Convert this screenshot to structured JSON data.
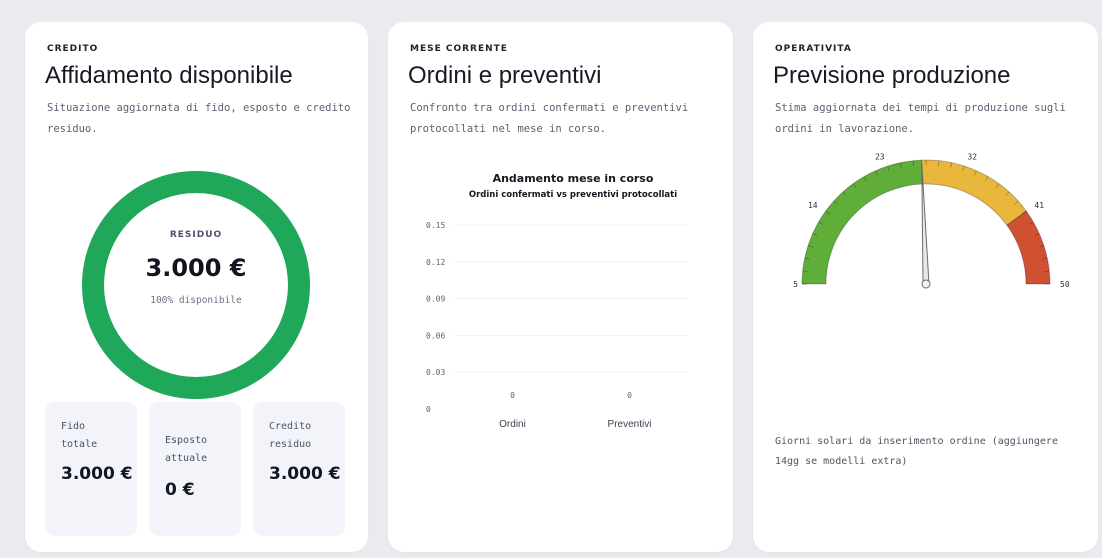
{
  "credit_card": {
    "eyebrow": "CREDITO",
    "title": "Affidamento disponibile",
    "description": "Situazione aggiornata di fido, esposto e credito residuo.",
    "ring_color": "#1fa75a",
    "ring_fraction": 1.0,
    "residuo_label": "RESIDUO",
    "residuo_value": "3.000 €",
    "residuo_sub": "100% disponibile",
    "stats": [
      {
        "label": "Fido totale",
        "value": "3.000 €"
      },
      {
        "label": "Esposto attuale",
        "value": "0 €"
      },
      {
        "label": "Credito residuo",
        "value": "3.000 €"
      }
    ]
  },
  "orders_card": {
    "eyebrow": "MESE CORRENTE",
    "title": "Ordini e preventivi",
    "description": "Confronto tra ordini confermati e preventivi protocollati nel mese in corso."
  },
  "chart_data": {
    "type": "bar",
    "title": "Andamento mese in corso",
    "subtitle": "Ordini confermati vs preventivi protocollati",
    "categories": [
      "Ordini",
      "Preventivi"
    ],
    "values": [
      0,
      0
    ],
    "data_labels": [
      "0",
      "0"
    ],
    "y_ticks": [
      "0",
      "0.03",
      "0.06",
      "0.09",
      "0.12",
      "0.15"
    ],
    "ylim": [
      0,
      0.15
    ],
    "grid": true,
    "legend": "none"
  },
  "production_card": {
    "eyebrow": "OPERATIVITA",
    "title": "Previsione produzione",
    "description": "Stima aggiornata dei tempi di produzione sugli ordini in lavorazione.",
    "gauge": {
      "min": 5,
      "max": 50,
      "value": 27,
      "ticks": [
        "5",
        "14",
        "23",
        "32",
        "41",
        "50"
      ],
      "bands": [
        {
          "from": 5,
          "to": 27,
          "color": "#5fae3a"
        },
        {
          "from": 27,
          "to": 41,
          "color": "#e8b73c"
        },
        {
          "from": 41,
          "to": 50,
          "color": "#cf5132"
        }
      ]
    },
    "note": "Giorni solari da inserimento ordine (aggiungere 14gg se modelli extra)"
  }
}
